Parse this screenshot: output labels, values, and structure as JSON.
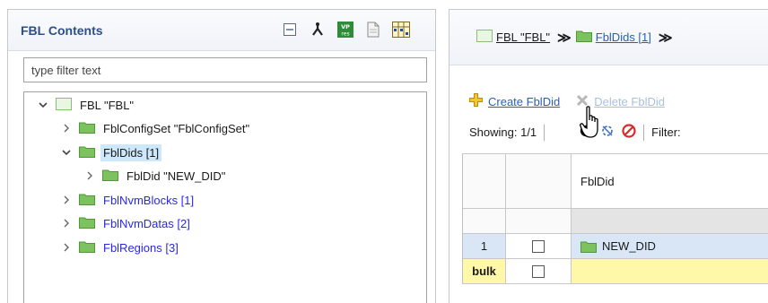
{
  "left_panel": {
    "title": "FBL Contents",
    "toolbar_icons": [
      "collapse-all-icon",
      "hierarchy-icon",
      "vp-res-icon",
      "document-icon",
      "layout-grid-icon"
    ],
    "vp_res_top": "VP",
    "vp_res_bottom": "res",
    "filter_placeholder": "type filter text",
    "tree": [
      {
        "label": "FBL \"FBL\"",
        "expanded": true,
        "depth": 0,
        "icon": "fbl-node-icon"
      },
      {
        "label": "FblConfigSet \"FblConfigSet\"",
        "expanded": false,
        "depth": 1,
        "icon": "folder-icon"
      },
      {
        "label": "FblDids [1]",
        "expanded": true,
        "depth": 1,
        "icon": "folder-icon",
        "selected": true
      },
      {
        "label": "FblDid \"NEW_DID\"",
        "expanded": false,
        "depth": 2,
        "icon": "folder-icon"
      },
      {
        "label": "FblNvmBlocks [1]",
        "expanded": false,
        "depth": 1,
        "icon": "folder-icon",
        "blue": true
      },
      {
        "label": "FblNvmDatas [2]",
        "expanded": false,
        "depth": 1,
        "icon": "folder-icon",
        "blue": true
      },
      {
        "label": "FblRegions [3]",
        "expanded": false,
        "depth": 1,
        "icon": "folder-icon",
        "blue": true
      }
    ]
  },
  "right_panel": {
    "breadcrumb": [
      {
        "label": "FBL \"FBL\"",
        "icon": "fbl-node-icon"
      },
      {
        "label": "FblDids [1]",
        "icon": "folder-icon"
      }
    ],
    "breadcrumb_sep": "≫",
    "create_label": "Create FblDid",
    "delete_label": "Delete FblDid",
    "showing_label": "Showing: 1/1",
    "filter_label": "Filter:",
    "table": {
      "column_header": "FblDid",
      "rows": [
        {
          "index": "1",
          "name": "NEW_DID"
        },
        {
          "index": "bulk",
          "name": ""
        }
      ]
    }
  },
  "colors": {
    "accent_title": "#2d4f86",
    "link_blue": "#2a5fb7",
    "tree_blue": "#2929e0",
    "selection": "#cde8fb",
    "row_highlight": "#d9e6f5",
    "bulk_yellow": "#fff8a8",
    "folder_green": "#7dc25f"
  }
}
